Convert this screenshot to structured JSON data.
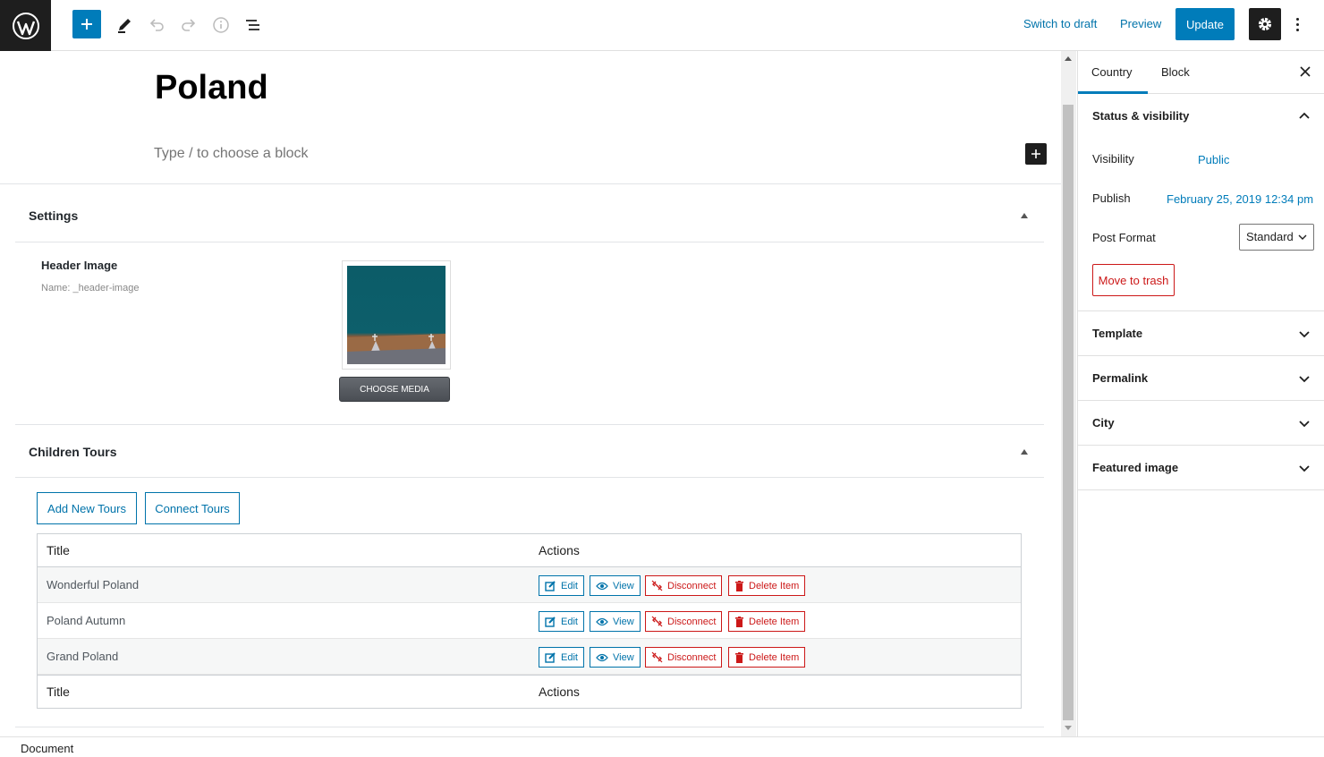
{
  "toolbar": {
    "switch_to_draft": "Switch to draft",
    "preview": "Preview",
    "update": "Update"
  },
  "post": {
    "title": "Poland",
    "block_placeholder": "Type / to choose a block"
  },
  "settings_box": {
    "title": "Settings",
    "field_label": "Header Image",
    "field_name": "Name: _header-image",
    "choose_media": "CHOOSE MEDIA"
  },
  "tours_box": {
    "title": "Children Tours",
    "add_new": "Add New Tours",
    "connect": "Connect Tours",
    "col_title": "Title",
    "col_actions": "Actions",
    "rows": [
      {
        "title": "Wonderful Poland"
      },
      {
        "title": "Poland Autumn"
      },
      {
        "title": "Grand Poland"
      }
    ],
    "actions": {
      "edit": "Edit",
      "view": "View",
      "disconnect": "Disconnect",
      "delete": "Delete Item"
    }
  },
  "sidebar": {
    "tab_country": "Country",
    "tab_block": "Block",
    "status_title": "Status & visibility",
    "visibility_label": "Visibility",
    "visibility_value": "Public",
    "publish_label": "Publish",
    "publish_value": "February 25, 2019 12:34 pm",
    "post_format_label": "Post Format",
    "post_format_value": "Standard",
    "move_to_trash": "Move to trash",
    "panels": [
      "Template",
      "Permalink",
      "City",
      "Featured image"
    ]
  },
  "footer": {
    "breadcrumb": "Document"
  },
  "colors": {
    "accent": "#007cba",
    "danger": "#cc1818",
    "dark": "#1e1e1e"
  }
}
